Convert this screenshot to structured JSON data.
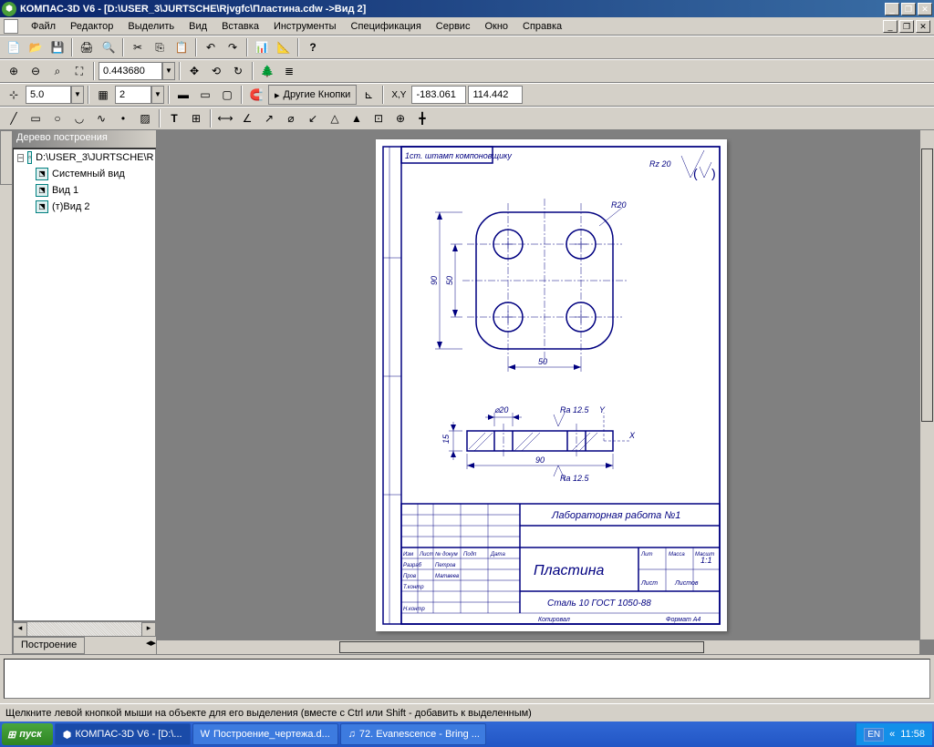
{
  "title": "КОМПАС-3D V6 - [D:\\USER_3\\JURTSCHE\\Rjvgfc\\Пластина.cdw ->Вид 2]",
  "menu": [
    "Файл",
    "Редактор",
    "Выделить",
    "Вид",
    "Вставка",
    "Инструменты",
    "Спецификация",
    "Сервис",
    "Окно",
    "Справка"
  ],
  "zoom_value": "0.443680",
  "grid_value": "5.0",
  "layer_value": "2",
  "other_buttons": "Другие Кнопки",
  "coord_label": "XY",
  "coord_x": "-183.061",
  "coord_y": "114.442",
  "tree": {
    "title": "Дерево построения",
    "root": "D:\\USER_3\\JURTSCHE\\R",
    "items": [
      "Системный вид",
      "Вид 1",
      "(т)Вид 2"
    ],
    "tab": "Построение"
  },
  "drawing": {
    "surface": "Rz 20",
    "dim_90v": "90",
    "dim_50v": "50",
    "dim_50h": "50",
    "dim_90h": "90",
    "dim_15": "15",
    "dim_d20": "⌀20",
    "dim_r20": "R20",
    "ra125": "Ra 12.5",
    "title_block": {
      "lab": "Лабораторная работа №1",
      "name": "Пластина",
      "mat": "Сталь 10 ГОСТ 1050-88",
      "scale": "1:1",
      "format": "Формат   A4",
      "copy": "Копировал"
    }
  },
  "status": "Щелкните левой кнопкой мыши на объекте для его выделения (вместе с Ctrl или Shift - добавить к выделенным)",
  "taskbar": {
    "start": "пуск",
    "items": [
      "КОМПАС-3D V6 - [D:\\...",
      "Построение_чертежа.d...",
      "72. Evanescence - Bring ..."
    ],
    "lang": "EN",
    "time": "11:58"
  }
}
